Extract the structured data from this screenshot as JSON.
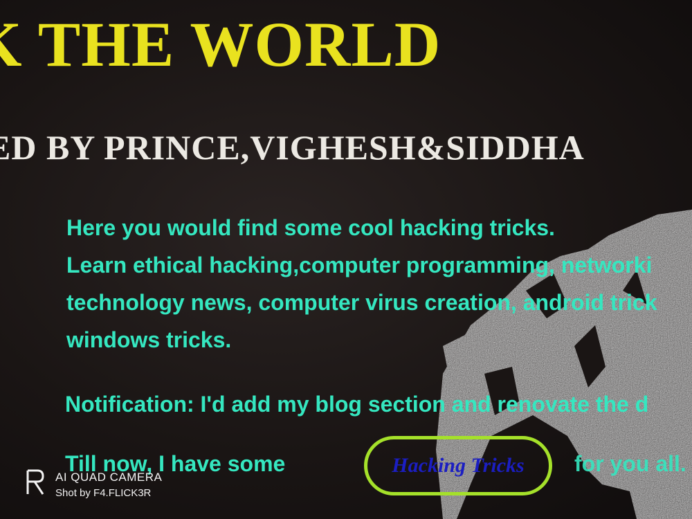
{
  "page": {
    "title": "K THE WORLD",
    "byline": "ED BY PRINCE,VIGHESH&SIDDHA"
  },
  "intro": {
    "lines": [
      "Here you would find some cool hacking tricks.",
      "Learn ethical hacking,computer programming, networki",
      "technology news, computer virus creation, android trick",
      "windows tricks."
    ]
  },
  "notification": "Notification: I'd add my blog section and renovate the d",
  "till_now": {
    "text": "Till now, I have some",
    "button_label": "Hacking Tricks",
    "trailing": "for you all."
  },
  "colors": {
    "title": "#e9e21f",
    "byline": "#ece9e3",
    "body_text": "#35e7c0",
    "button_border": "#a5e12a",
    "button_text": "#1b1ec2"
  },
  "watermark": {
    "title": "AI QUAD CAMERA",
    "subtitle": "Shot by F4.FLICK3R",
    "icon": "realme-r-logo"
  }
}
